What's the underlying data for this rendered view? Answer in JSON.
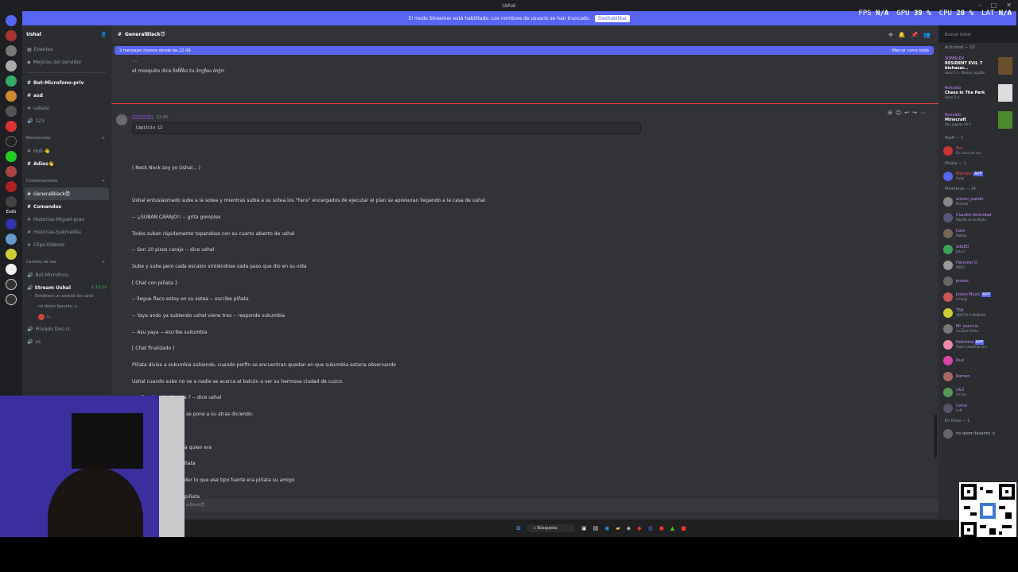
{
  "window": {
    "title": "Ushal"
  },
  "hud": {
    "fps_label": "FPS",
    "fps_value": "N/A",
    "gpu_label": "GPU",
    "gpu_value": "39 %",
    "cpu_label": "CPU",
    "cpu_value": "20 %",
    "lat_label": "LAT",
    "lat_value": "N/A"
  },
  "streamer_bar": {
    "text": "El modo Streamer está habilitado. Los nombres de usuario se han truncado.",
    "button": "Deshabilitar"
  },
  "server": {
    "name": "Ushal"
  },
  "channels": {
    "top": [
      "Eventos",
      "Mejoras del servidor"
    ],
    "ungrouped": [
      "Bot-Microfono-priv",
      "asd",
      "usbani",
      "123"
    ],
    "cat_bienvenidas": "Bienvenidas",
    "bienvenidas": [
      "Holi-👋",
      "Adios👋"
    ],
    "cat_conversaciones": "Conversaciones",
    "conversaciones": [
      "GeneralBlack😈",
      "Comandos",
      "Historias-Miguel-gran",
      "Historias-Sukmaldia",
      "Clips-Videoss"
    ],
    "cat_voz": "Canales de voz",
    "voz": [
      "Bot-Microfono",
      "Stream Ushal",
      "Privado Dos-cc",
      "vs"
    ],
    "stream_time": "1:13:23",
    "stream_sub": "Establece un estado de canal",
    "stream_user1": "mi doom favorito :v",
    "stream_user2": "u..."
  },
  "channel": {
    "name": "GeneralBlack😈"
  },
  "search": {
    "placeholder": "Buscar Ushal"
  },
  "new_messages": {
    "text": "2 mensajes nuevos desde las 22:49",
    "action": "Marcar como leído"
  },
  "messages": {
    "top_line": "el mosquito dice ჩინჩხა tu პოეზია ბიჭო",
    "author_time": "22:49",
    "code": "Capitulo 12",
    "lines": [
      "( Nock Nock soy yo Ushal... )",
      "Ushal entusiasmado sube a la sotea y mientras subia a su sotea los \"Fans\" encargados de ejecutar el plan se apresuran llegando a la casa de ushal",
      "-- ¡¡SUBAN CARAJO!! -- grita gomplex",
      "Todos suben rápidamente topandose con su cuarto abierto de ushal",
      "-- Son 10 pisos carajo -- dice ushal",
      "Sube y sube pero cada escalon sintiéndose cada paso que dio en su vida",
      "[ Chat con piñata ]",
      "-- llegue flaco estoy en su sotea -- escribe piñata",
      "-- Yaya ando ya subiendo ushal viene tras -- responde sukumbia",
      "-- Asu yaya -- escribe sukumbia",
      "[ Chat finalizado ]",
      "Piñata divisa a sukumbia subiendo, cuando porfin se encuentran quedan en que sukumbia estaria observando",
      "Ushal cuando sube no ve a nadie se acerca al balcón a ver su hermosa ciudad de cuzco.",
      "-- ¿ Donde mierda esta ? -- dice ushal",
      "Y el formidable piñata se pone a su atras diciendo:",
      "a quien era",
      "ñata",
      "der lo que ese tipo fuerte era piñata su amigo",
      "piñata",
      "shal"
    ]
  },
  "composer": {
    "placeholder": "alBlack😈"
  },
  "members": {
    "activity_header": "Actividad — 15",
    "activities": [
      {
        "user": "SOMBLEX",
        "game": "RESIDENT EVIL 7 biohazar...",
        "time": "Hace 1 h · Nuevo jugador"
      },
      {
        "user": "Ronaldo",
        "game": "Chess In The Park",
        "time": "Hace 2 d"
      },
      {
        "user": "Ronaldo",
        "game": "Minecraft",
        "time": "Has jugado 29 h"
      }
    ],
    "staff_header": "Staff — 1",
    "staff": [
      {
        "name": "Mo...",
        "status": "En canal de voz"
      }
    ],
    "pinata_header": "Piñata — 1",
    "pinata": [
      {
        "name": "Membot",
        "badge": "APP",
        "status": "!help"
      }
    ],
    "miembros_header": "Miembros — 14",
    "miembros": [
      {
        "name": "antoni_jeatdit",
        "status": "Portada"
      },
      {
        "name": "Claudio Velocidad",
        "status": "Rápido es de Nada"
      },
      {
        "name": "Dani",
        "status": "Roblox"
      },
      {
        "name": "eduED",
        "status": "Jota-2"
      },
      {
        "name": "Hammer O",
        "status": "WOLF"
      },
      {
        "name": "jessee",
        "status": ""
      },
      {
        "name": "Jockie Music",
        "badge": "APP",
        "status": "m!help"
      },
      {
        "name": "TSR",
        "status": "ADICTO A ROBLOX"
      },
      {
        "name": "Mr_esencia",
        "status": "Counter-Strike"
      },
      {
        "name": "Nekotina",
        "badge": "APP",
        "status": "Slash nekotina.com"
      },
      {
        "name": "Paul",
        "status": ""
      },
      {
        "name": "Romeo",
        "status": ""
      },
      {
        "name": "u&3",
        "status": "en bus"
      },
      {
        "name": "Ushal",
        "status": "Left"
      }
    ],
    "online_header": "En línea — 1",
    "online": [
      {
        "name": "mi doom favorito :v",
        "status": ""
      }
    ]
  },
  "taskbar": {
    "search": "Búsqueda"
  },
  "server_badge": "EsdG"
}
